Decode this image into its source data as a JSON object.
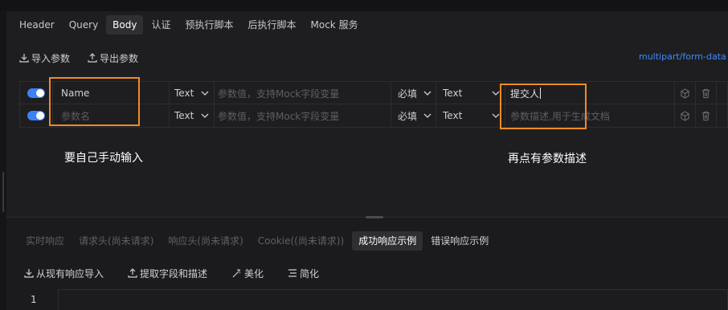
{
  "tabs": [
    {
      "label": "Header",
      "active": false
    },
    {
      "label": "Query",
      "active": false
    },
    {
      "label": "Body",
      "active": true
    },
    {
      "label": "认证",
      "active": false
    },
    {
      "label": "预执行脚本",
      "active": false
    },
    {
      "label": "后执行脚本",
      "active": false
    },
    {
      "label": "Mock 服务",
      "active": false
    }
  ],
  "body_toolbar": {
    "import_label": "导入参数",
    "export_label": "导出参数",
    "content_type": "multipart/form-data"
  },
  "params": [
    {
      "enabled": true,
      "name": "Name",
      "name_placeholder": "参数名",
      "type": "Text",
      "value_placeholder": "参数值，支持Mock字段变量",
      "required": "必填",
      "value_type": "Text",
      "description": "提交人",
      "description_placeholder": "参数描述,用于生成文档"
    },
    {
      "enabled": true,
      "name": "",
      "name_placeholder": "参数名",
      "type": "Text",
      "value_placeholder": "参数值，支持Mock字段变量",
      "required": "必填",
      "value_type": "Text",
      "description": "",
      "description_placeholder": "参数描述,用于生成文档"
    }
  ],
  "annotations": {
    "left_note": "要自己手动输入",
    "right_note": "再点有参数描述",
    "box_color": "#f08a24"
  },
  "response_tabs": [
    {
      "label": "实时响应",
      "state": "disabled"
    },
    {
      "label": "请求头(尚未请求)",
      "state": "disabled"
    },
    {
      "label": "响应头(尚未请求)",
      "state": "disabled"
    },
    {
      "label": "Cookie((尚未请求))",
      "state": "disabled"
    },
    {
      "label": "成功响应示例",
      "state": "active"
    },
    {
      "label": "错误响应示例",
      "state": "normal"
    }
  ],
  "response_tools": {
    "import_label": "从现有响应导入",
    "extract_label": "提取字段和描述",
    "beautify_label": "美化",
    "simplify_label": "简化"
  },
  "editor": {
    "line_number": "1"
  },
  "colors": {
    "accent": "#3b82f6",
    "link": "#3d8bff",
    "annotation": "#f08a24"
  },
  "icons": {
    "download": "download-icon",
    "upload": "upload-icon",
    "chevron": "chevron-down-icon",
    "cube": "cube-icon",
    "trash": "trash-icon",
    "wand": "magic-wand-icon",
    "list": "list-icon"
  }
}
